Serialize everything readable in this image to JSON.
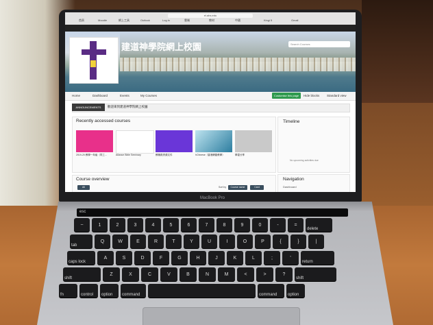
{
  "site": {
    "title": "建道神學院網上校園",
    "search_placeholder": "Search Courses",
    "url": "el.abs.edu"
  },
  "browser": {
    "tabs": [
      "首頁",
      "Moodle",
      "網上工具",
      "Outlook",
      "Log in",
      "雲端",
      "教材",
      "中國",
      "Kingi 5",
      "Gmail"
    ]
  },
  "menu": {
    "home": "Home",
    "dashboard": "Dashboard",
    "events": "Events",
    "my_courses": "My Courses",
    "customise": "Customise this page",
    "hide_blocks": "Hide blocks",
    "standard_view": "Standard view"
  },
  "announcement": {
    "label": "ANNOUNCEMENTS",
    "text": "歡迎來到建道神學院網上校園"
  },
  "recent": {
    "title": "Recently accessed courses",
    "cards": [
      {
        "label": "2019-20 教學一年級（同工…"
      },
      {
        "label": "Alliance Bible Seminary"
      },
      {
        "label": "教職員資源文件"
      },
      {
        "label": "hChinese（香港網路教學）"
      },
      {
        "label": "學習分享"
      }
    ]
  },
  "overview": {
    "title": "Course overview",
    "filter": "All",
    "sort_label": "Sort by",
    "sort_value": "Course name",
    "view": "Card"
  },
  "timeline": {
    "title": "Timeline",
    "empty": "No upcoming activities due"
  },
  "navigation": {
    "title": "Navigation",
    "item": "Dashboard"
  },
  "laptop": {
    "brand": "MacBook Pro",
    "keys_row1": [
      "~",
      "1",
      "2",
      "3",
      "4",
      "5",
      "6",
      "7",
      "8",
      "9",
      "0",
      "-",
      "=",
      "delete"
    ],
    "keys_row2": [
      "tab",
      "Q",
      "W",
      "E",
      "R",
      "T",
      "Y",
      "U",
      "I",
      "O",
      "P",
      "{",
      "}",
      "|"
    ],
    "keys_row3": [
      "caps lock",
      "A",
      "S",
      "D",
      "F",
      "G",
      "H",
      "J",
      "K",
      "L",
      ";",
      "'",
      "return"
    ],
    "keys_row4": [
      "shift",
      "Z",
      "X",
      "C",
      "V",
      "B",
      "N",
      "M",
      "<",
      ">",
      "?",
      "shift"
    ],
    "keys_row5": [
      "fn",
      "control",
      "option",
      "command",
      "",
      "command",
      "option"
    ],
    "esc": "esc"
  }
}
